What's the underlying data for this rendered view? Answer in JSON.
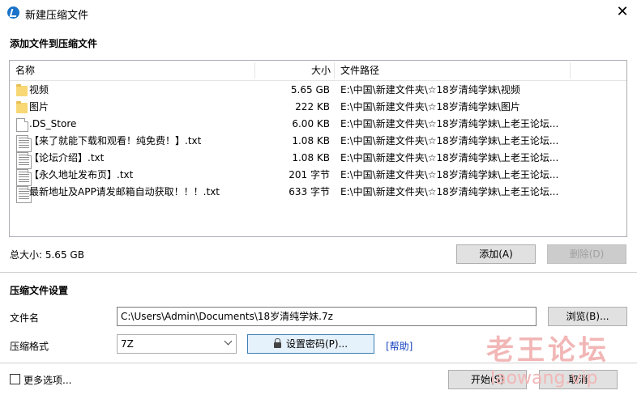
{
  "window": {
    "title": "新建压缩文件",
    "close_label": "✕"
  },
  "add_section": {
    "heading": "添加文件到压缩文件"
  },
  "list": {
    "columns": {
      "name": "名称",
      "size": "大小",
      "path": "文件路径"
    },
    "rows": [
      {
        "icon": "folder-icon",
        "name": "视频",
        "size": "5.65 GB",
        "path": "E:\\中国\\新建文件夹\\☆18岁清纯学妹\\视频"
      },
      {
        "icon": "folder-icon",
        "name": "图片",
        "size": "222 KB",
        "path": "E:\\中国\\新建文件夹\\☆18岁清纯学妹\\图片"
      },
      {
        "icon": "file-icon",
        "name": ".DS_Store",
        "size": "6.00 KB",
        "path": "E:\\中国\\新建文件夹\\☆18岁清纯学妹\\上老王论坛..."
      },
      {
        "icon": "text-file-icon",
        "name": "【来了就能下载和观看！纯免费！】.txt",
        "size": "1.08 KB",
        "path": "E:\\中国\\新建文件夹\\☆18岁清纯学妹\\上老王论坛..."
      },
      {
        "icon": "text-file-icon",
        "name": "【论坛介绍】.txt",
        "size": "1.08 KB",
        "path": "E:\\中国\\新建文件夹\\☆18岁清纯学妹\\上老王论坛..."
      },
      {
        "icon": "text-file-icon",
        "name": "【永久地址发布页】.txt",
        "size": "201 字节",
        "path": "E:\\中国\\新建文件夹\\☆18岁清纯学妹\\上老王论坛..."
      },
      {
        "icon": "text-file-icon",
        "name": "最新地址及APP请发邮箱自动获取！！！.txt",
        "size": "633 字节",
        "path": "E:\\中国\\新建文件夹\\☆18岁清纯学妹\\上老王论坛..."
      }
    ]
  },
  "summary": {
    "total_size": "总大小: 5.65 GB"
  },
  "buttons": {
    "add": "添加(A)",
    "delete": "删除(D)",
    "browse": "浏览(B)...",
    "set_password": "设置密码(P)...",
    "start": "开始(S)",
    "cancel": "取消"
  },
  "settings": {
    "heading": "压缩文件设置",
    "filename_label": "文件名",
    "filename_value": "C:\\Users\\Admin\\Documents\\18岁清纯学妹.7z",
    "format_label": "压缩格式",
    "format_value": "7Z",
    "help_link": "[帮助]"
  },
  "footer": {
    "more_options": "更多选项..."
  },
  "watermark": {
    "main": "老王论坛",
    "sub": "laowang.vip"
  }
}
